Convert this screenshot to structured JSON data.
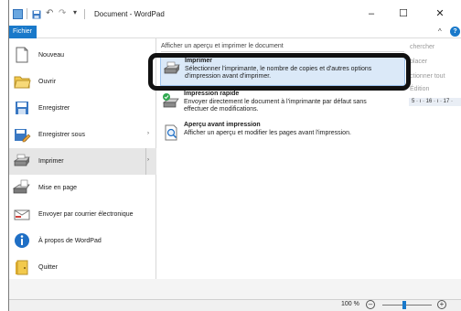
{
  "window": {
    "title": "Document - WordPad",
    "minimize": "–",
    "maximize": "☐",
    "close": "✕"
  },
  "ribbon": {
    "file_tab": "Fichier",
    "help": "?"
  },
  "menu": {
    "items": [
      {
        "label": "Nouveau",
        "icon": "new-document-icon"
      },
      {
        "label": "Ouvrir",
        "icon": "open-folder-icon"
      },
      {
        "label": "Enregistrer",
        "icon": "save-icon"
      },
      {
        "label": "Enregistrer sous",
        "icon": "save-as-icon",
        "arrow": "›"
      },
      {
        "label": "Imprimer",
        "icon": "printer-icon",
        "arrow": "›"
      },
      {
        "label": "Mise en page",
        "icon": "page-setup-icon"
      },
      {
        "label": "Envoyer par courrier électronique",
        "icon": "email-icon"
      },
      {
        "label": "À propos de WordPad",
        "icon": "info-icon"
      },
      {
        "label": "Quitter",
        "icon": "exit-icon"
      }
    ]
  },
  "submenu": {
    "header": "Afficher un aperçu et imprimer le document",
    "items": [
      {
        "title": "Imprimer",
        "desc1": "Sélectionner l'imprimante, le nombre de copies et d'autres options",
        "desc2": "d'impression avant d'imprimer."
      },
      {
        "title": "Impression rapide",
        "desc1": "Envoyer directement le document à l'imprimante par défaut sans",
        "desc2": "effectuer de modifications."
      },
      {
        "title": "Aperçu avant impression",
        "desc1": "Afficher un aperçu et modifier les pages avant l'impression.",
        "desc2": ""
      }
    ]
  },
  "background": {
    "lines": [
      "chercher",
      "placer",
      "ctionner tout",
      "Édition"
    ],
    "ruler": "5 · ı · 16 · ı · 17 ·"
  },
  "status": {
    "zoom": "100 %",
    "zoom_out": "–",
    "zoom_in": "+"
  },
  "colors": {
    "accent": "#1979ca",
    "highlight": "#dbe9f8"
  }
}
